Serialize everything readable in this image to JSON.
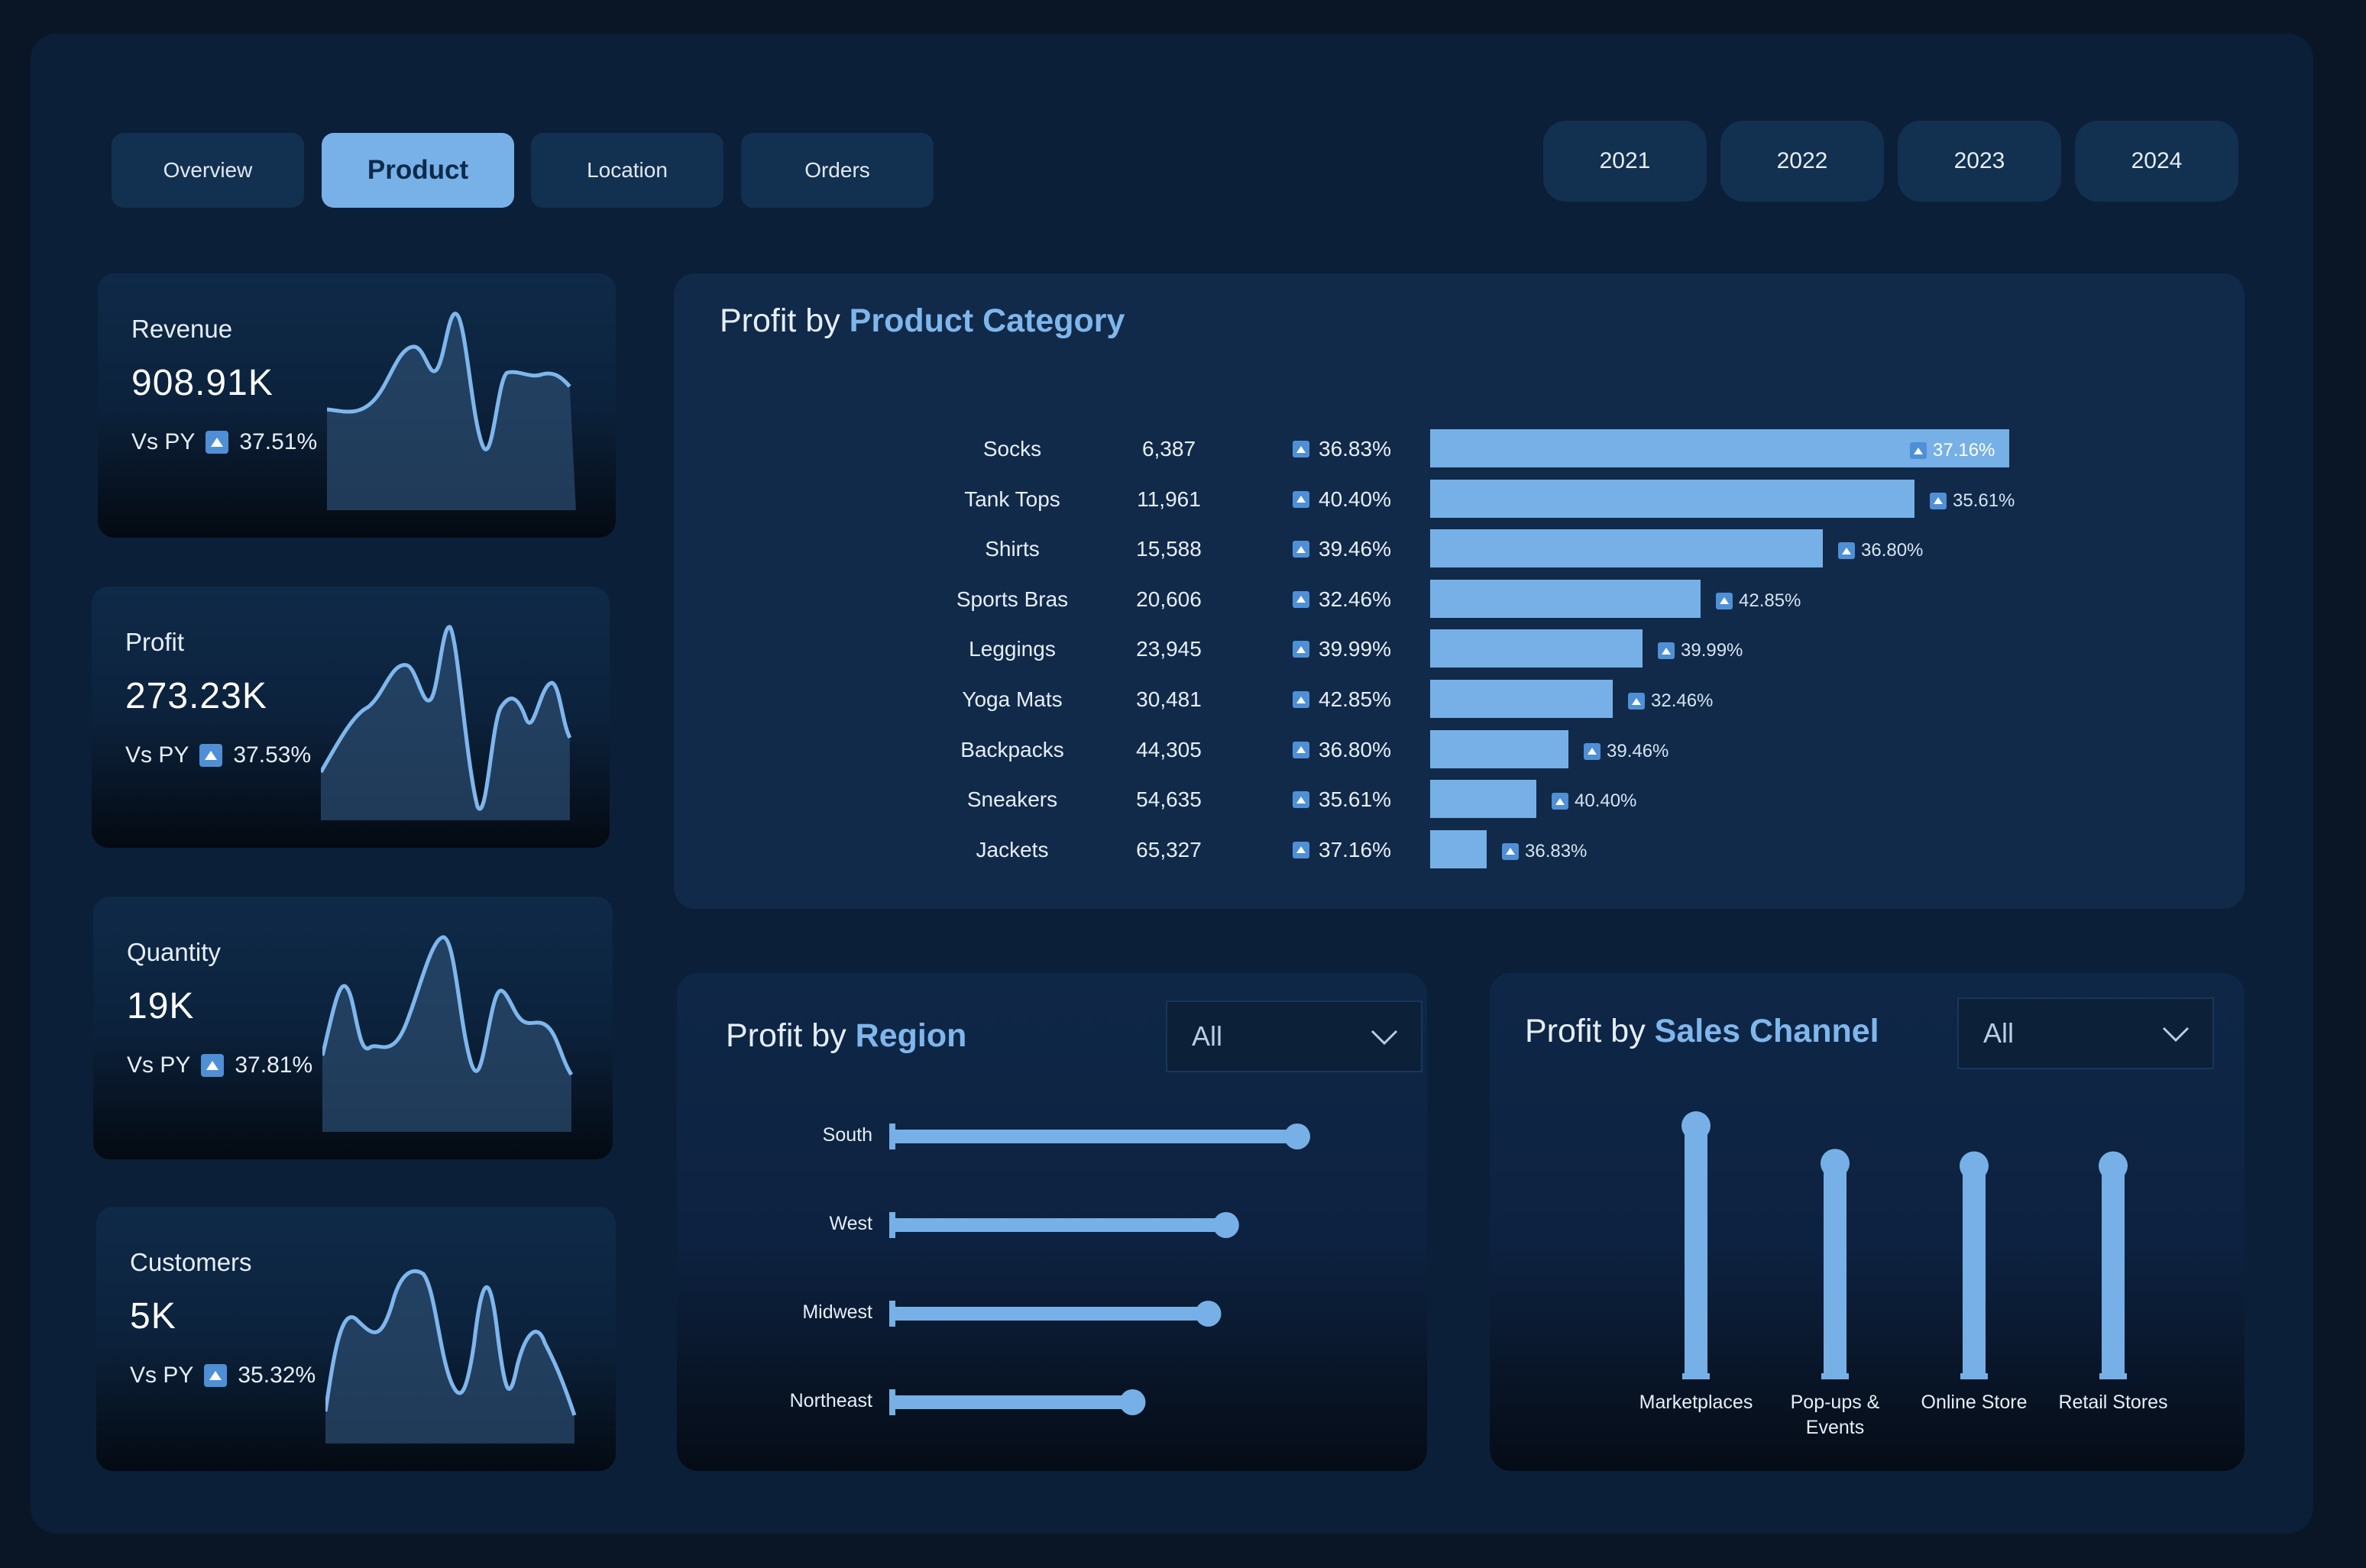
{
  "nav": {
    "tabs": [
      "Overview",
      "Product",
      "Location",
      "Orders"
    ],
    "active_tab": "Product",
    "years": [
      "2021",
      "2022",
      "2023",
      "2024"
    ]
  },
  "kpis": [
    {
      "label": "Revenue",
      "value": "908.91K",
      "vs_label": "Vs PY",
      "change": "37.51%"
    },
    {
      "label": "Profit",
      "value": "273.23K",
      "vs_label": "Vs PY",
      "change": "37.53%"
    },
    {
      "label": "Quantity",
      "value": "19K",
      "vs_label": "Vs PY",
      "change": "37.81%"
    },
    {
      "label": "Customers",
      "value": "5K",
      "vs_label": "Vs PY",
      "change": "35.32%"
    }
  ],
  "category_panel": {
    "title_plain": "Profit by ",
    "title_accent": "Product Category"
  },
  "region_panel": {
    "title_plain": "Profit by ",
    "title_accent": "Region",
    "filter_value": "All"
  },
  "channel_panel": {
    "title_plain": "Profit by ",
    "title_accent": "Sales Channel",
    "filter_value": "All"
  },
  "colors": {
    "accent": "#7fb6ec",
    "bar": "#76b0e6",
    "background": "#0a1626",
    "panel": "#112a49"
  },
  "icons": {
    "change": "up-triangle-icon",
    "dropdown": "chevron-down-icon"
  },
  "chart_data": [
    {
      "type": "table",
      "title": "Profit by Product Category",
      "rows": [
        {
          "category": "Socks",
          "profit": "6,387",
          "change": "36.83%",
          "bar_change": "37.16%",
          "bar_value": 65327
        },
        {
          "category": "Tank Tops",
          "profit": "11,961",
          "change": "40.40%",
          "bar_change": "35.61%",
          "bar_value": 54635
        },
        {
          "category": "Shirts",
          "profit": "15,588",
          "change": "39.46%",
          "bar_change": "36.80%",
          "bar_value": 44305
        },
        {
          "category": "Sports Bras",
          "profit": "20,606",
          "change": "32.46%",
          "bar_change": "42.85%",
          "bar_value": 30481
        },
        {
          "category": "Leggings",
          "profit": "23,945",
          "change": "39.99%",
          "bar_change": "39.99%",
          "bar_value": 23945
        },
        {
          "category": "Yoga Mats",
          "profit": "30,481",
          "change": "42.85%",
          "bar_change": "32.46%",
          "bar_value": 20606
        },
        {
          "category": "Backpacks",
          "profit": "44,305",
          "change": "36.80%",
          "bar_change": "39.46%",
          "bar_value": 15588
        },
        {
          "category": "Sneakers",
          "profit": "54,635",
          "change": "35.61%",
          "bar_change": "40.40%",
          "bar_value": 11961
        },
        {
          "category": "Jackets",
          "profit": "65,327",
          "change": "37.16%",
          "bar_change": "36.83%",
          "bar_value": 6387
        }
      ],
      "xlim": [
        0,
        65327
      ]
    },
    {
      "type": "bar",
      "title": "Profit by Region",
      "orientation": "horizontal",
      "categories": [
        "South",
        "West",
        "Midwest",
        "Northeast"
      ],
      "values": [
        91000,
        75000,
        71000,
        54000
      ],
      "xlim": [
        0,
        91000
      ]
    },
    {
      "type": "bar",
      "title": "Profit by Sales Channel",
      "orientation": "vertical",
      "categories": [
        "Marketplaces",
        "Pop-ups & Events",
        "Online Store",
        "Retail Stores"
      ],
      "values": [
        100,
        85,
        84,
        84
      ],
      "ylim": [
        0,
        100
      ]
    }
  ]
}
